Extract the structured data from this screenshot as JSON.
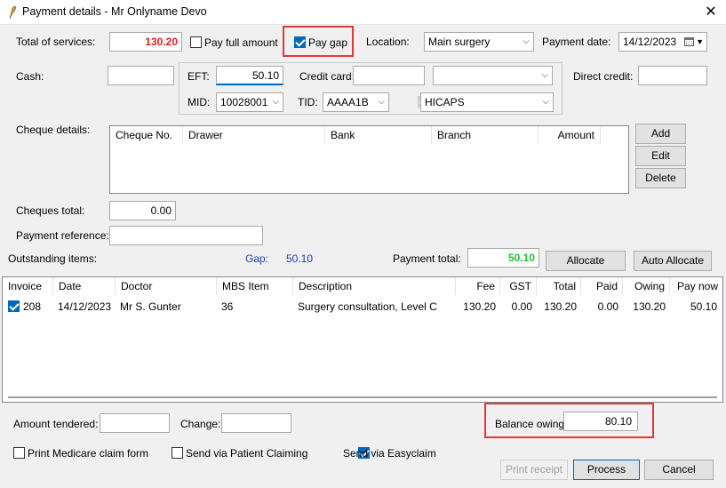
{
  "window": {
    "title": "Payment details - Mr Onlyname Devo",
    "close_glyph": "✕"
  },
  "top": {
    "total_services_label": "Total of services:",
    "total_services_value": "130.20",
    "pay_full_amount_label": "Pay full amount",
    "pay_gap_label": "Pay gap",
    "location_label": "Location:",
    "location_value": "Main surgery",
    "payment_date_label": "Payment date:",
    "payment_date_value": "14/12/2023"
  },
  "cash": {
    "label": "Cash:",
    "value": ""
  },
  "eft": {
    "label": "EFT:",
    "value": "50.10",
    "credit_card_label": "Credit card:",
    "credit_card_value": "",
    "card_type_value": "",
    "mid_label": "MID:",
    "mid_value": "10028001",
    "tid_label": "TID:",
    "tid_value": "AAAA1B",
    "hicaps_value": "HICAPS"
  },
  "direct_credit": {
    "label": "Direct credit:",
    "value": ""
  },
  "cheques": {
    "label": "Cheque details:",
    "columns": [
      "Cheque No.",
      "Drawer",
      "Bank",
      "Branch",
      "Amount"
    ],
    "add_label": "Add",
    "edit_label": "Edit",
    "delete_label": "Delete",
    "total_label": "Cheques total:",
    "total_value": "0.00"
  },
  "payment_reference": {
    "label": "Payment reference:",
    "value": ""
  },
  "outstanding": {
    "label": "Outstanding items:",
    "gap_label": "Gap:",
    "gap_value": "50.10",
    "payment_total_label": "Payment total:",
    "payment_total_value": "50.10",
    "allocate_label": "Allocate",
    "auto_allocate_label": "Auto Allocate"
  },
  "items": {
    "columns": [
      "Invoice",
      "Date",
      "Doctor",
      "MBS Item",
      "Description",
      "Fee",
      "GST",
      "Total",
      "Paid",
      "Owing",
      "Pay now"
    ],
    "rows": [
      {
        "invoice": "208",
        "date": "14/12/2023",
        "doctor": "Mr S. Gunter",
        "mbs_item": "36",
        "description": "Surgery consultation, Level C",
        "fee": "130.20",
        "gst": "0.00",
        "total": "130.20",
        "paid": "0.00",
        "owing": "130.20",
        "pay_now": "50.10"
      }
    ]
  },
  "bottom": {
    "amount_tendered_label": "Amount tendered:",
    "amount_tendered_value": "",
    "change_label": "Change:",
    "change_value": "",
    "balance_owing_label": "Balance owing:",
    "balance_owing_value": "80.10",
    "print_medicare_label": "Print Medicare claim form",
    "send_patient_claiming_label": "Send via Patient Claiming",
    "send_easyclaim_label": "Send via Easyclaim",
    "print_receipt_label": "Print receipt",
    "process_label": "Process",
    "cancel_label": "Cancel"
  },
  "colors": {
    "total_red": "#e02020",
    "payment_green": "#22c32e",
    "gap_blue": "#1a3fbf",
    "highlight_frame": "#e0383e"
  }
}
